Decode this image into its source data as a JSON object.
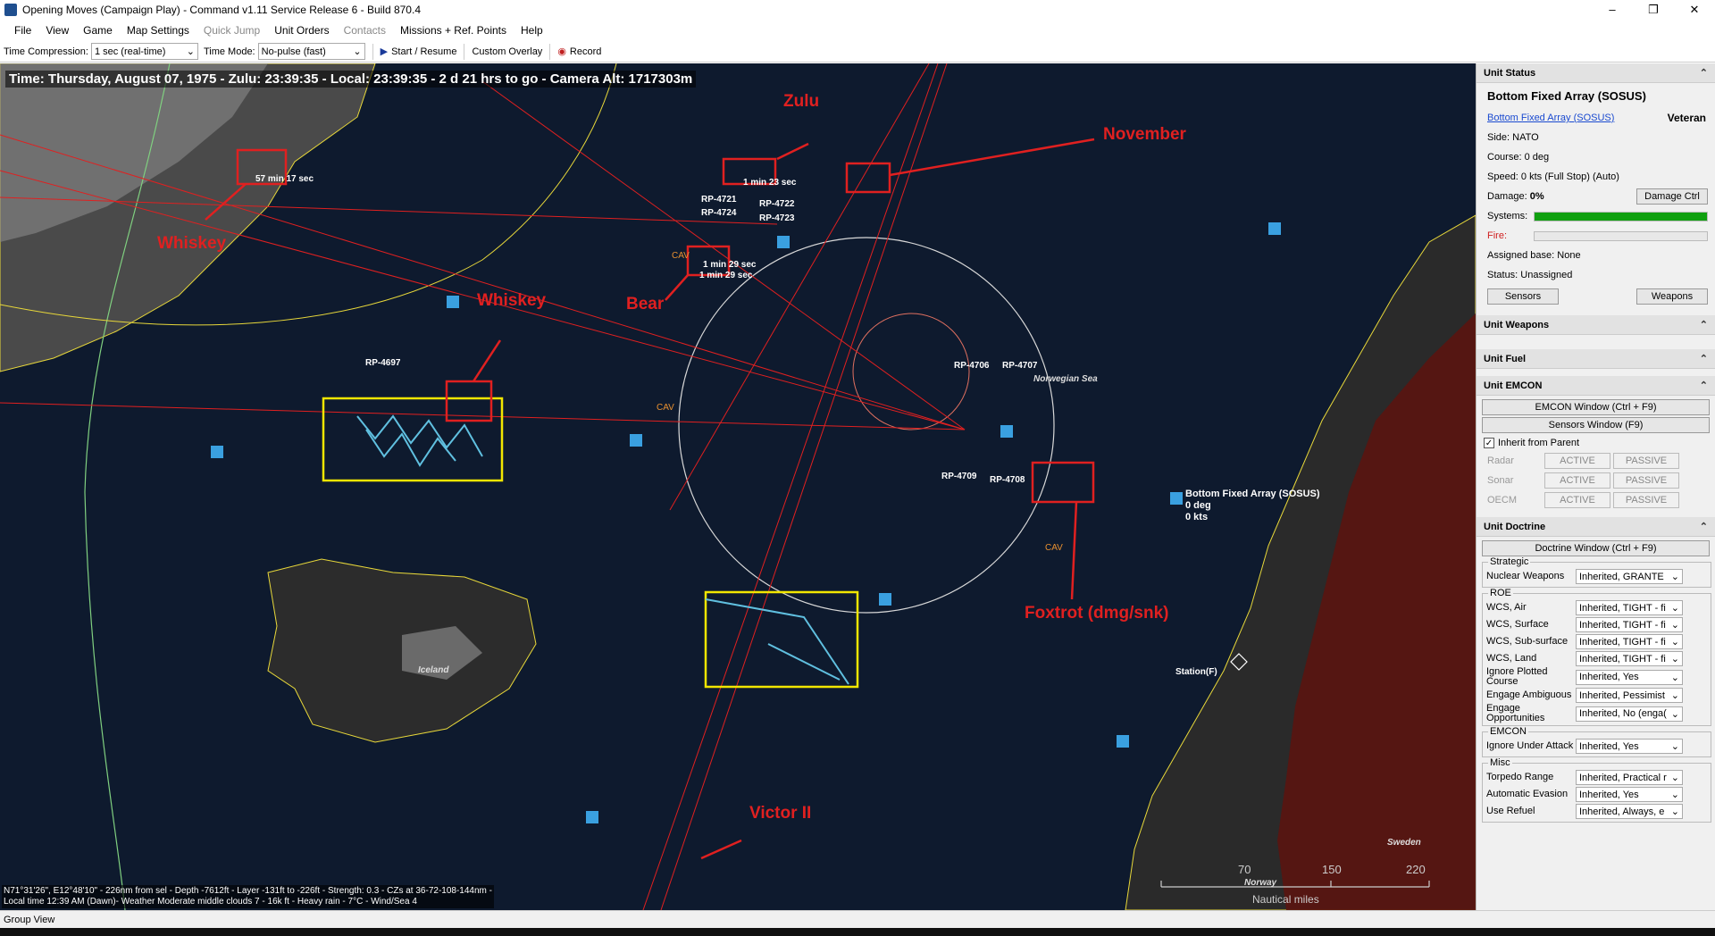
{
  "window": {
    "title": "Opening Moves (Campaign Play) - Command v1.11 Service Release 6 - Build 870.4",
    "min": "–",
    "max": "❐",
    "close": "✕"
  },
  "menu": [
    {
      "label": "File"
    },
    {
      "label": "View"
    },
    {
      "label": "Game"
    },
    {
      "label": "Map Settings"
    },
    {
      "label": "Quick Jump",
      "disabled": true
    },
    {
      "label": "Unit Orders"
    },
    {
      "label": "Contacts",
      "disabled": true
    },
    {
      "label": "Missions + Ref. Points"
    },
    {
      "label": "Help"
    }
  ],
  "toolbar": {
    "time_compression_label": "Time Compression:",
    "time_compression_value": "1 sec (real-time)",
    "time_mode_label": "Time Mode:",
    "time_mode_value": "No-pulse (fast)",
    "start_label": "Start / Resume",
    "custom_overlay_label": "Custom Overlay",
    "record_label": "Record"
  },
  "map": {
    "hud": "Time: Thursday, August 07, 1975 - Zulu: 23:39:35 - Local: 23:39:35 - 2 d 21 hrs to go -  Camera Alt: 1717303m",
    "coord_line1": "N71°31'26\", E12°48'10\" - 226nm from sel - Depth -7612ft - Layer -131ft to -226ft - Strength: 0.3 - CZs at 36-72-108-144nm -",
    "coord_line2": "Local time 12:39 AM (Dawn)- Weather Moderate middle clouds 7 - 16k ft - Heavy rain - 7°C - Wind/Sea 4",
    "annotations": {
      "zulu": "Zulu",
      "november": "November",
      "whiskey1": "Whiskey",
      "whiskey2": "Whiskey",
      "bear": "Bear",
      "foxtrot": "Foxtrot (dmg/snk)",
      "victor": "Victor II"
    },
    "labels": {
      "iceland": "Iceland",
      "norwegian_sea": "Norwegian Sea",
      "sweden": "Sweden",
      "norway": "Norway",
      "station": "Station(F)",
      "rp4697": "RP-4697",
      "rp4706": "RP-4706",
      "rp4707": "RP-4707",
      "rp4708": "RP-4708",
      "rp4709": "RP-4709",
      "rp4721": "RP-4721",
      "rp4722": "RP-4722",
      "rp4723": "RP-4723",
      "rp4724": "RP-4724",
      "timer1": "57 min 17 sec",
      "timer2": "1 min 23 sec",
      "timer3": "1 min 29 sec",
      "timer4": "1 min 29 sec",
      "cav1": "CAV",
      "cav2": "CAV",
      "cav3": "CAV",
      "sel_name": "Bottom Fixed Array (SOSUS)",
      "sel_course": "0 deg",
      "sel_speed": "0 kts"
    },
    "scale": {
      "s70": "70",
      "s150": "150",
      "s220": "220",
      "unit": "Nautical miles"
    }
  },
  "panel": {
    "unit_status": "Unit Status",
    "unit_name": "Bottom Fixed Array (SOSUS)",
    "unit_link": "Bottom Fixed Array (SOSUS)",
    "proficiency": "Veteran",
    "side": "Side: NATO",
    "course": "Course: 0 deg",
    "speed": "Speed: 0 kts (Full Stop)   (Auto)",
    "damage_label": "Damage:",
    "damage_value": "0%",
    "damage_ctrl": "Damage Ctrl",
    "systems_label": "Systems:",
    "systems_pct": 100,
    "fire_label": "Fire:",
    "fire_pct": 0,
    "assigned_base": "Assigned base: None",
    "status": "Status: Unassigned",
    "sensors_btn": "Sensors",
    "weapons_btn": "Weapons",
    "unit_weapons": "Unit Weapons",
    "unit_fuel": "Unit Fuel",
    "unit_emcon": "Unit EMCON",
    "emcon_window": "EMCON Window (Ctrl + F9)",
    "sensors_window": "Sensors Window (F9)",
    "inherit": "Inherit from Parent",
    "emcon_rows": [
      {
        "name": "Radar",
        "a": "ACTIVE",
        "p": "PASSIVE"
      },
      {
        "name": "Sonar",
        "a": "ACTIVE",
        "p": "PASSIVE"
      },
      {
        "name": "OECM",
        "a": "ACTIVE",
        "p": "PASSIVE"
      }
    ],
    "unit_doctrine": "Unit Doctrine",
    "doctrine_window": "Doctrine Window (Ctrl + F9)",
    "strategic_title": "Strategic",
    "nuclear_label": "Nuclear Weapons",
    "nuclear_value": "Inherited, GRANTE",
    "roe_title": "ROE",
    "roe": [
      {
        "n": "WCS, Air",
        "v": "Inherited, TIGHT - fi"
      },
      {
        "n": "WCS, Surface",
        "v": "Inherited, TIGHT - fi"
      },
      {
        "n": "WCS, Sub-surface",
        "v": "Inherited, TIGHT - fi"
      },
      {
        "n": "WCS, Land",
        "v": "Inherited, TIGHT - fi"
      },
      {
        "n": "Ignore Plotted Course",
        "v": "Inherited, Yes"
      },
      {
        "n": "Engage Ambiguous",
        "v": "Inherited, Pessimist"
      },
      {
        "n": "Engage Opportunities",
        "v": "Inherited, No (enga("
      }
    ],
    "emcon_title": "EMCON",
    "ignore_attack_label": "Ignore Under Attack",
    "ignore_attack_value": "Inherited, Yes",
    "misc_title": "Misc",
    "misc": [
      {
        "n": "Torpedo Range",
        "v": "Inherited, Practical r"
      },
      {
        "n": "Automatic Evasion",
        "v": "Inherited, Yes"
      },
      {
        "n": "Use Refuel",
        "v": "Inherited, Always, e"
      }
    ]
  },
  "statusbar": {
    "text": "Group View"
  },
  "colors": {
    "sea": "#0e1a2e",
    "annotation": "#e02020",
    "highlight_yellow": "#f2e600",
    "sosus": "#3aa0e0",
    "land": "#2a2a2a",
    "enemy_land": "#5a1410"
  }
}
